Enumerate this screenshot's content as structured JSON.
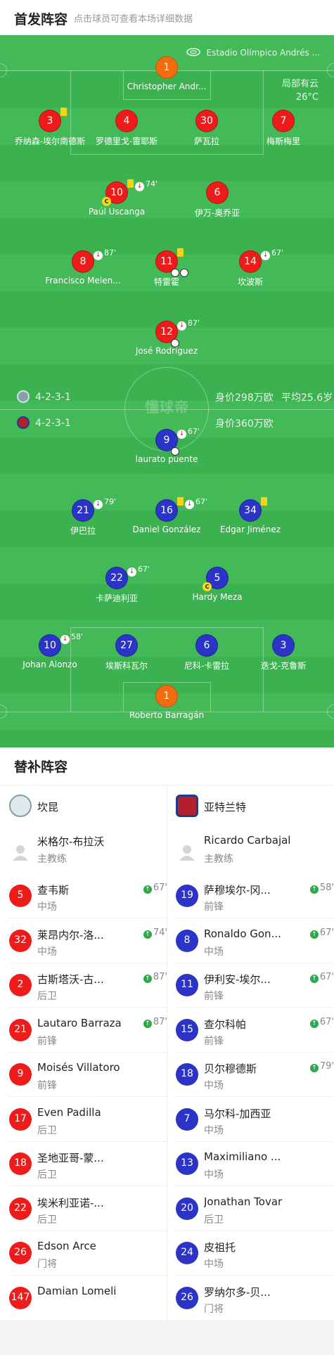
{
  "header": {
    "title": "首发阵容",
    "subtitle": "点击球员可查看本场详细数据"
  },
  "stadium": "Estadio Olímpico Andrés ...",
  "weather": {
    "condition": "局部有云",
    "temp": "26°C"
  },
  "home": {
    "formation": "4-2-3-1",
    "value": "身价298万欧",
    "avg_age": "平均25.6岁",
    "color": "#ee1b1b",
    "players": [
      {
        "num": "1",
        "name": "Christopher Andr...",
        "gk": true
      },
      {
        "num": "3",
        "name": "乔纳森-埃尔南德斯",
        "yellow": true
      },
      {
        "num": "4",
        "name": "罗德里戈-雷耶斯"
      },
      {
        "num": "30",
        "name": "萨瓦拉"
      },
      {
        "num": "7",
        "name": "梅斯梅里"
      },
      {
        "num": "10",
        "name": "Paúl Uscanga",
        "yellow": true,
        "subout": "74'",
        "captain": true
      },
      {
        "num": "6",
        "name": "伊万-奥乔亚"
      },
      {
        "num": "8",
        "name": "Francisco Melen...",
        "subout": "87'"
      },
      {
        "num": "11",
        "name": "特雷霍",
        "yellow": true,
        "goals": 2
      },
      {
        "num": "14",
        "name": "坎波斯",
        "subout": "67'"
      },
      {
        "num": "12",
        "name": "José Rodríguez",
        "subout": "87'",
        "goals": 1
      }
    ]
  },
  "away": {
    "formation": "4-2-3-1",
    "value": "身价360万欧",
    "color": "#2b34c6",
    "players": [
      {
        "num": "9",
        "name": "laurato puente",
        "subout": "67'",
        "goals": 1
      },
      {
        "num": "21",
        "name": "伊巴拉",
        "subout": "79'"
      },
      {
        "num": "16",
        "name": "Daniel González",
        "yellow": true,
        "subout": "67'"
      },
      {
        "num": "34",
        "name": "Edgar Jiménez",
        "yellow": true
      },
      {
        "num": "22",
        "name": "卡萨迪利亚",
        "subout": "67'"
      },
      {
        "num": "5",
        "name": "Hardy Meza",
        "captain": true
      },
      {
        "num": "10",
        "name": "Johan Alonzo",
        "subout": "58'"
      },
      {
        "num": "27",
        "name": "埃斯科瓦尔"
      },
      {
        "num": "6",
        "name": "尼科-卡雷拉"
      },
      {
        "num": "3",
        "name": "迭戈-克鲁斯"
      },
      {
        "num": "1",
        "name": "Roberto Barragán",
        "gk": true
      }
    ]
  },
  "watermark": "懂球帝",
  "subs": {
    "title": "替补阵容",
    "home_team": "坎昆",
    "away_team": "亚特兰特",
    "home_coach": {
      "name": "米格尔-布拉沃",
      "role": "主教练"
    },
    "away_coach": {
      "name": "Ricardo Carbajal",
      "role": "主教练"
    },
    "home": [
      {
        "num": "5",
        "name": "查韦斯",
        "pos": "中场",
        "in": "67'"
      },
      {
        "num": "32",
        "name": "莱昂内尔-洛...",
        "pos": "中场",
        "in": "74'"
      },
      {
        "num": "2",
        "name": "古斯塔沃-古...",
        "pos": "后卫",
        "in": "87'"
      },
      {
        "num": "21",
        "name": "Lautaro Barraza",
        "pos": "前锋",
        "in": "87'"
      },
      {
        "num": "9",
        "name": "Moisés Villatoro",
        "pos": "前锋",
        "in": ""
      },
      {
        "num": "17",
        "name": "Even Padilla",
        "pos": "后卫",
        "in": ""
      },
      {
        "num": "18",
        "name": "圣地亚哥-蒙...",
        "pos": "后卫",
        "in": ""
      },
      {
        "num": "22",
        "name": "埃米利亚诺-...",
        "pos": "后卫",
        "in": ""
      },
      {
        "num": "26",
        "name": "Edson Arce",
        "pos": "门将",
        "in": ""
      },
      {
        "num": "147",
        "name": "Damian Lomeli",
        "pos": "",
        "in": ""
      }
    ],
    "away": [
      {
        "num": "19",
        "name": "萨穆埃尔-冈...",
        "pos": "前锋",
        "in": "58'"
      },
      {
        "num": "8",
        "name": "Ronaldo Gon...",
        "pos": "中场",
        "in": "67'"
      },
      {
        "num": "11",
        "name": "伊利安-埃尔...",
        "pos": "前锋",
        "in": "67'"
      },
      {
        "num": "15",
        "name": "查尔科帕",
        "pos": "前锋",
        "in": "67'"
      },
      {
        "num": "18",
        "name": "贝尔穆德斯",
        "pos": "中场",
        "in": "79'"
      },
      {
        "num": "7",
        "name": "马尔科-加西亚",
        "pos": "中场",
        "in": ""
      },
      {
        "num": "13",
        "name": "Maximiliano ...",
        "pos": "中场",
        "in": ""
      },
      {
        "num": "20",
        "name": "Jonathan Tovar",
        "pos": "后卫",
        "in": ""
      },
      {
        "num": "24",
        "name": "皮祖托",
        "pos": "中场",
        "in": ""
      },
      {
        "num": "26",
        "name": "罗纳尔多-贝...",
        "pos": "门将",
        "in": ""
      }
    ]
  }
}
